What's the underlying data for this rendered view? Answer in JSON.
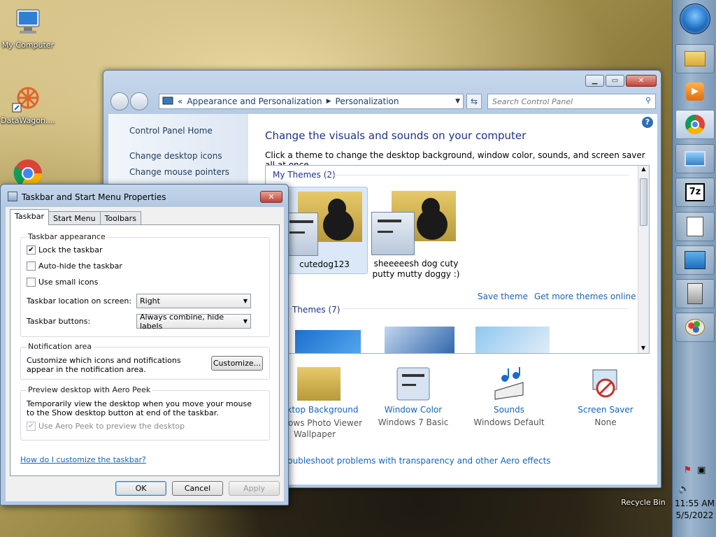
{
  "desktop": {
    "icons": [
      {
        "label": "My Computer",
        "icon": "computer-icon"
      },
      {
        "label": "DataWagon....",
        "icon": "datawagon-icon"
      },
      {
        "label": "",
        "icon": "chrome-icon"
      },
      {
        "label": "Recycle Bin",
        "icon": "recycle-bin-icon"
      }
    ]
  },
  "taskbar": {
    "buttons": [
      "start-orb",
      "file-explorer",
      "media-player",
      "chrome",
      "picture-viewer",
      "7zip",
      "notepad",
      "control-panel",
      "device-manager",
      "paint"
    ],
    "clock": {
      "time": "11:55 AM",
      "date": "5/5/2022"
    }
  },
  "control_panel": {
    "address": {
      "root": "«",
      "crumbs": [
        "Appearance and Personalization",
        "Personalization"
      ]
    },
    "search_placeholder": "Search Control Panel",
    "sidebar": {
      "links": [
        "Control Panel Home",
        "Change desktop icons",
        "Change mouse pointers"
      ]
    },
    "heading": "Change the visuals and sounds on your computer",
    "subheading": "Click a theme to change the desktop background, window color, sounds, and screen saver all at once.",
    "my_themes_header": "My Themes (2)",
    "themes": [
      {
        "name": "cutedog123",
        "selected": true
      },
      {
        "name": "sheeeeesh dog cuty putty mutty doggy :)",
        "selected": false
      }
    ],
    "theme_links": {
      "save": "Save theme",
      "more": "Get more themes online"
    },
    "aero_header": "Themes (7)",
    "bottom": [
      {
        "title": "Desktop Background",
        "value": "Windows Photo Viewer Wallpaper"
      },
      {
        "title": "Window Color",
        "value": "Windows 7 Basic"
      },
      {
        "title": "Sounds",
        "value": "Windows Default"
      },
      {
        "title": "Screen Saver",
        "value": "None"
      }
    ],
    "troubleshoot": "Troubleshoot problems with transparency and other Aero effects"
  },
  "dialog": {
    "title": "Taskbar and Start Menu Properties",
    "close_label": "✕",
    "tabs": [
      "Taskbar",
      "Start Menu",
      "Toolbars"
    ],
    "appearance": {
      "title": "Taskbar appearance",
      "lock": "Lock the taskbar",
      "autohide": "Auto-hide the taskbar",
      "small_icons": "Use small icons",
      "location_label": "Taskbar location on screen:",
      "location_value": "Right",
      "buttons_label": "Taskbar buttons:",
      "buttons_value": "Always combine, hide labels"
    },
    "notification": {
      "title": "Notification area",
      "text": "Customize which icons and notifications appear in the notification area.",
      "button": "Customize..."
    },
    "peek": {
      "title": "Preview desktop with Aero Peek",
      "text": "Temporarily view the desktop when you move your mouse to the Show desktop button at end of the taskbar.",
      "checkbox": "Use Aero Peek to preview the desktop"
    },
    "help_link": "How do I customize the taskbar?",
    "ok": "OK",
    "cancel": "Cancel",
    "apply": "Apply"
  }
}
